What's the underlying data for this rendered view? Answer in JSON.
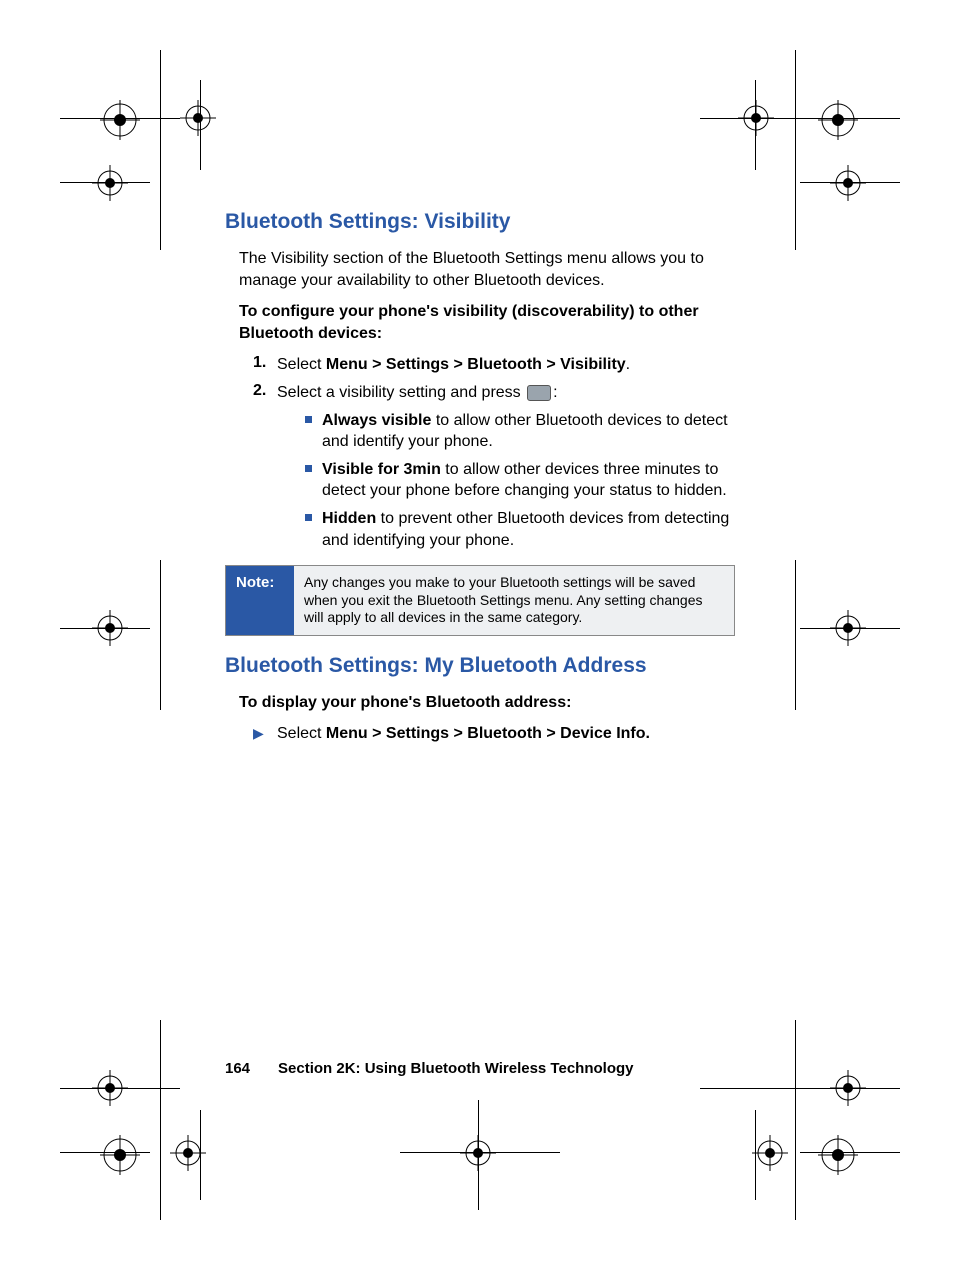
{
  "section1": {
    "heading": "Bluetooth Settings: Visibility",
    "intro": "The Visibility section of the Bluetooth Settings menu allows you to manage your availability to other Bluetooth devices.",
    "configLead": "To configure your phone's visibility (discoverability) to other Bluetooth devices:",
    "step1": {
      "num": "1.",
      "pre": "Select ",
      "bold": "Menu > Settings > Bluetooth > Visibility",
      "post": "."
    },
    "step2": {
      "num": "2.",
      "pre": "Select a visibility setting and press ",
      "post": ":"
    },
    "opts": [
      {
        "bold": "Always visible",
        "rest": " to allow other Bluetooth devices to detect and identify your phone."
      },
      {
        "bold": "Visible for 3min",
        "rest": " to allow other devices three minutes to detect your phone before changing your status to hidden."
      },
      {
        "bold": "Hidden",
        "rest": " to prevent other Bluetooth devices from detecting and identifying your phone."
      }
    ],
    "note": {
      "label": "Note:",
      "text": "Any changes you make to your Bluetooth settings will be saved when you exit the Bluetooth Settings menu. Any setting changes will apply to all devices in the same category."
    }
  },
  "section2": {
    "heading": "Bluetooth Settings: My Bluetooth Address",
    "lead": "To display your phone's Bluetooth address:",
    "bullet": {
      "pre": "Select ",
      "bold": "Menu > Settings > Bluetooth > Device Info."
    }
  },
  "footer": {
    "page": "164",
    "section": "Section 2K: Using Bluetooth Wireless Technology"
  }
}
